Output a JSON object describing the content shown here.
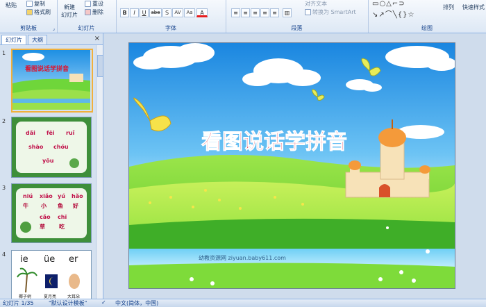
{
  "ribbon": {
    "clipboard": {
      "paste": "粘贴",
      "copy": "复制",
      "format_painter": "格式刷",
      "label": "剪贴板"
    },
    "slides": {
      "new_slide": "新建",
      "new_slide_2": "幻灯片",
      "reset": "重设",
      "delete": "删除",
      "label": "幻灯片"
    },
    "font": {
      "label": "字体",
      "bold": "B",
      "italic": "I",
      "underline": "U",
      "strike": "abe",
      "shadow": "S",
      "spacing": "AV",
      "case": "Aa"
    },
    "paragraph": {
      "label": "段落",
      "align_text": "对齐文本",
      "smartart": "转换为 SmartArt"
    },
    "drawing": {
      "arrange": "排列",
      "quick_styles": "快速样式",
      "label": "绘图"
    }
  },
  "panel": {
    "tabs": [
      "幻灯片",
      "大纲"
    ],
    "close": "×",
    "slides": [
      {
        "num": "1",
        "title": "看图说话学拼音"
      },
      {
        "num": "2",
        "rows": [
          [
            "dǎi",
            "fēi",
            "ruǐ"
          ],
          [
            "shào",
            "chóu"
          ],
          [
            "yōu"
          ]
        ]
      },
      {
        "num": "3",
        "pinyin": [
          "niú",
          "xiǎo",
          "yú",
          "hǎo"
        ],
        "hanzi": [
          "牛",
          "小",
          "鱼",
          "好"
        ],
        "pinyin2": [
          "cǎo",
          "chī"
        ],
        "hanzi2": [
          "草",
          "吃"
        ]
      },
      {
        "num": "4",
        "finals": [
          "ie",
          "üe",
          "er"
        ],
        "captions": [
          "椰子树",
          "夏月亮",
          "大耳朵"
        ]
      }
    ]
  },
  "slide": {
    "title": "看图说话学拼音",
    "watermark": "幼教资源网 ziyuan.baby611.com"
  },
  "status": {
    "slide_info": "幻灯片 1/35",
    "theme": "\"默认设计模板\"",
    "language": "中文(简体，中国)"
  },
  "colors": {
    "title_red": "#e0102a",
    "sky": "#3ba4e8",
    "grass": "#5fcf2a"
  }
}
